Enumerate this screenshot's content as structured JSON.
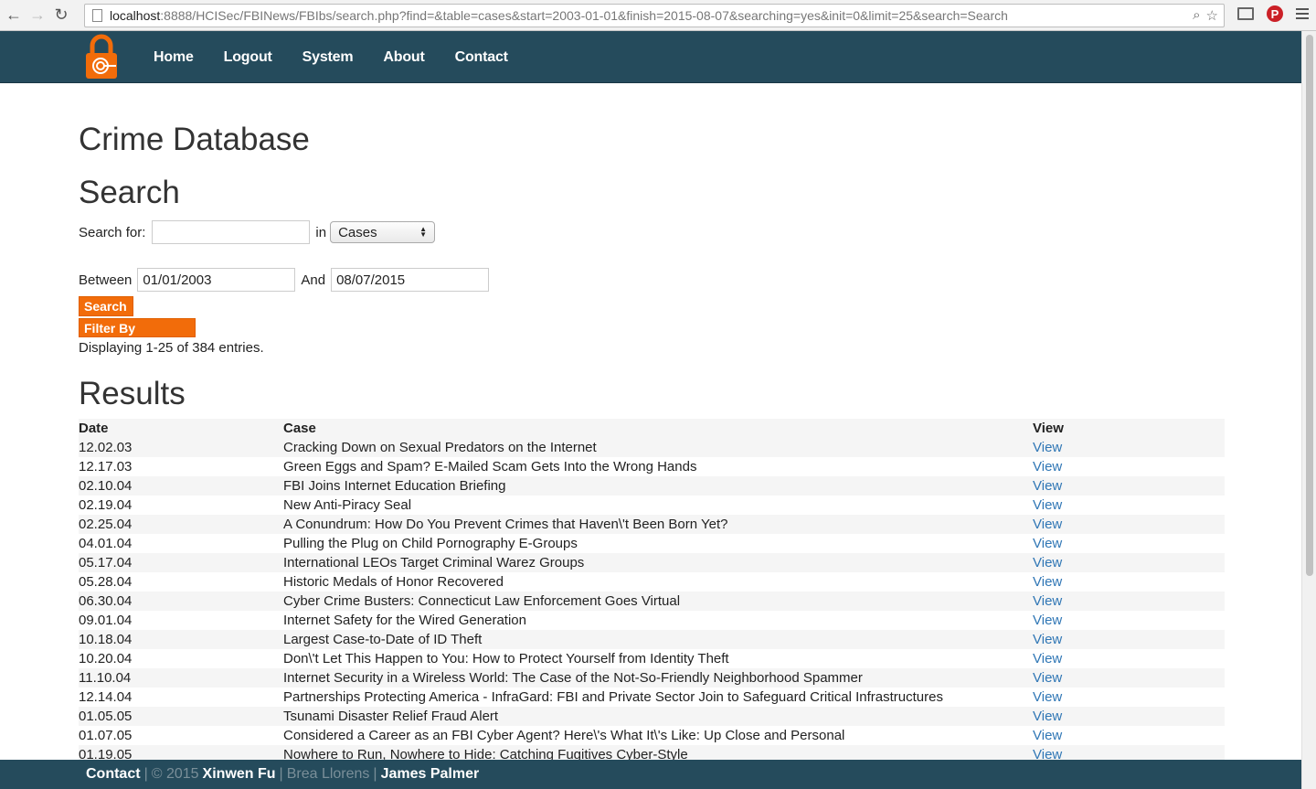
{
  "browser": {
    "url_host": "localhost",
    "url_rest": ":8888/HCISec/FBINews/FBIbs/search.php?find=&table=cases&start=2003-01-01&finish=2015-08-07&searching=yes&init=0&limit=25&search=Search"
  },
  "nav": {
    "items": [
      {
        "label": "Home"
      },
      {
        "label": "Logout"
      },
      {
        "label": "System"
      },
      {
        "label": "About"
      },
      {
        "label": "Contact"
      }
    ]
  },
  "page": {
    "title": "Crime Database",
    "search_heading": "Search",
    "search_for_label": "Search for:",
    "search_value": "",
    "in_label": "in",
    "table_select": "Cases",
    "between_label": "Between",
    "start_date": "01/01/2003",
    "and_label": "And",
    "end_date": "08/07/2015",
    "search_button": "Search",
    "filter_button": "Filter By Category",
    "display_text": "Displaying 1-25 of 384 entries.",
    "results_heading": "Results"
  },
  "table": {
    "headers": [
      "Date",
      "Case",
      "View"
    ],
    "rows": [
      {
        "date": "12.02.03",
        "case": "Cracking Down on Sexual Predators on the Internet",
        "view": "View"
      },
      {
        "date": "12.17.03",
        "case": "Green Eggs and Spam? E-Mailed Scam Gets Into the Wrong Hands",
        "view": "View"
      },
      {
        "date": "02.10.04",
        "case": "FBI Joins Internet Education Briefing",
        "view": "View"
      },
      {
        "date": "02.19.04",
        "case": "New Anti-Piracy Seal",
        "view": "View"
      },
      {
        "date": "02.25.04",
        "case": "A Conundrum: How Do You Prevent Crimes that Haven\\'t Been Born Yet?",
        "view": "View"
      },
      {
        "date": "04.01.04",
        "case": "Pulling the Plug on Child Pornography E-Groups",
        "view": "View"
      },
      {
        "date": "05.17.04",
        "case": "International LEOs Target Criminal Warez Groups",
        "view": "View"
      },
      {
        "date": "05.28.04",
        "case": "Historic Medals of Honor Recovered",
        "view": "View"
      },
      {
        "date": "06.30.04",
        "case": "Cyber Crime Busters: Connecticut Law Enforcement Goes Virtual",
        "view": "View"
      },
      {
        "date": "09.01.04",
        "case": "Internet Safety for the Wired Generation",
        "view": "View"
      },
      {
        "date": "10.18.04",
        "case": "Largest Case-to-Date of ID Theft",
        "view": "View"
      },
      {
        "date": "10.20.04",
        "case": "Don\\'t Let This Happen to You: How to Protect Yourself from Identity Theft",
        "view": "View"
      },
      {
        "date": "11.10.04",
        "case": "Internet Security in a Wireless World: The Case of the Not-So-Friendly Neighborhood Spammer",
        "view": "View"
      },
      {
        "date": "12.14.04",
        "case": "Partnerships Protecting America - InfraGard: FBI and Private Sector Join to Safeguard Critical Infrastructures",
        "view": "View"
      },
      {
        "date": "01.05.05",
        "case": "Tsunami Disaster Relief Fraud Alert",
        "view": "View"
      },
      {
        "date": "01.07.05",
        "case": "Considered a Career as an FBI Cyber Agent? Here\\'s What It\\'s Like: Up Close and Personal",
        "view": "View"
      },
      {
        "date": "01.19.05",
        "case": "Nowhere to Run, Nowhere to Hide: Catching Fugitives Cyber-Style",
        "view": "View"
      }
    ]
  },
  "footer": {
    "contact": "Contact",
    "sep1": "|",
    "copyright": "© 2015",
    "author1": "Xinwen Fu",
    "sep2": "|",
    "author2": "Brea Llorens",
    "sep3": "|",
    "author3": "James Palmer"
  }
}
